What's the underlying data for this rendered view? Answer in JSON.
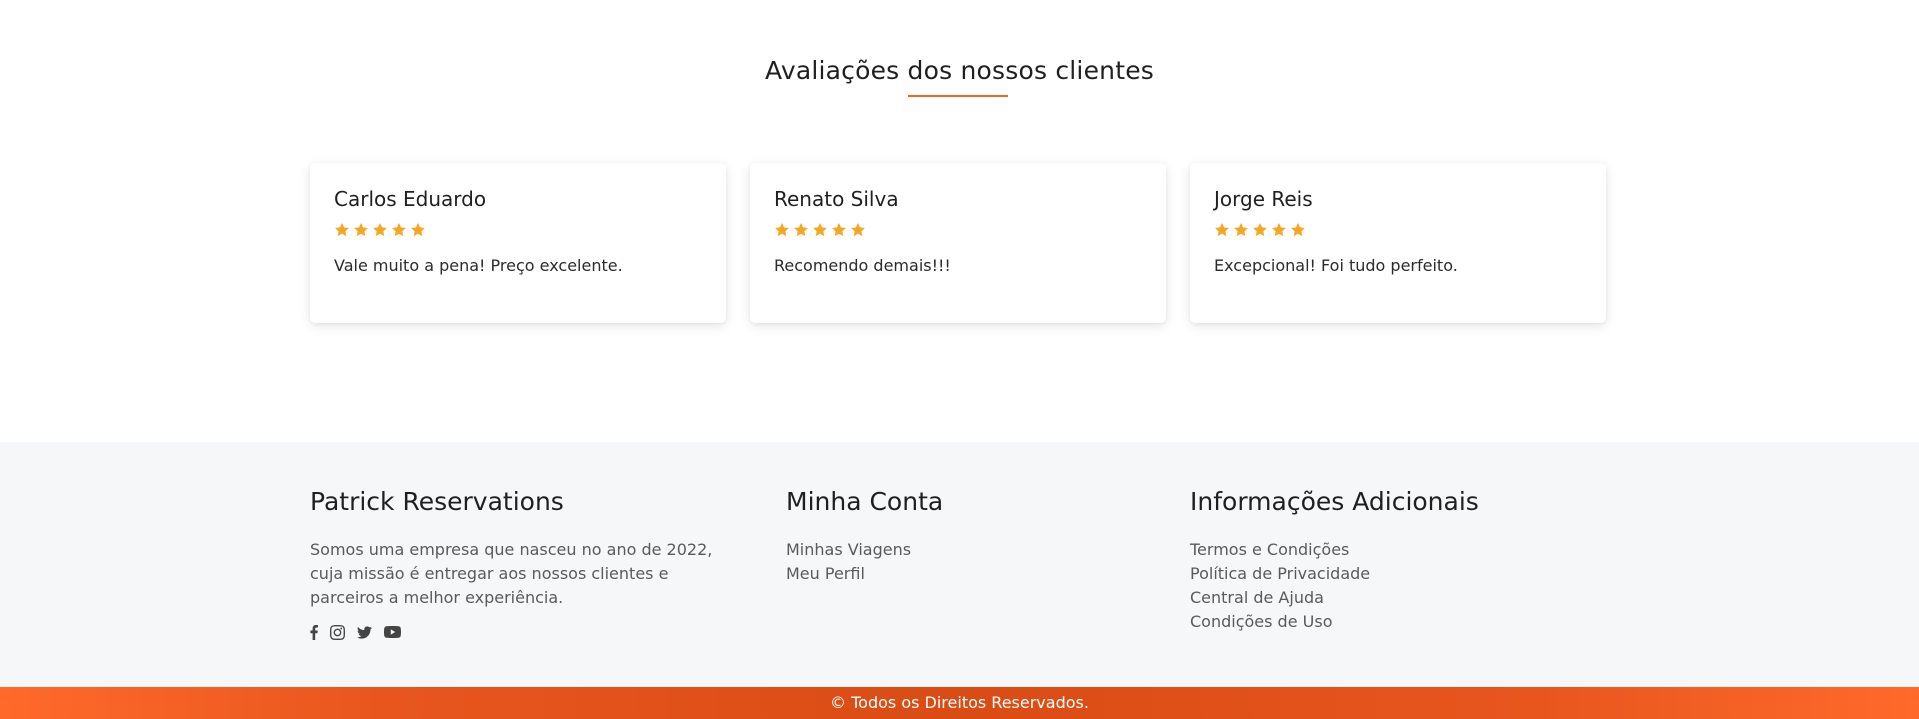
{
  "reviews": {
    "title": "Avaliações dos nossos clientes",
    "accent_color": "#f0632a",
    "star_color": "#f5a623",
    "items": [
      {
        "name": "Carlos Eduardo",
        "rating": 5,
        "text": "Vale muito a pena! Preço excelente."
      },
      {
        "name": "Renato Silva",
        "rating": 5,
        "text": "Recomendo demais!!!"
      },
      {
        "name": "Jorge Reis",
        "rating": 5,
        "text": "Excepcional! Foi tudo perfeito."
      }
    ]
  },
  "footer": {
    "about": {
      "heading": "Patrick Reservations",
      "text": "Somos uma empresa que nasceu no ano de 2022, cuja missão é entregar aos nossos clientes e parceiros a melhor experiência.",
      "social": [
        "facebook-icon",
        "instagram-icon",
        "twitter-icon",
        "youtube-icon"
      ]
    },
    "account": {
      "heading": "Minha Conta",
      "links": [
        "Minhas Viagens",
        "Meu Perfil"
      ]
    },
    "info": {
      "heading": "Informações Adicionais",
      "links": [
        "Termos e Condições",
        "Política de Privacidade",
        "Central de Ajuda",
        "Condições de Uso"
      ]
    },
    "copyright": "© Todos os Direitos Reservados."
  }
}
